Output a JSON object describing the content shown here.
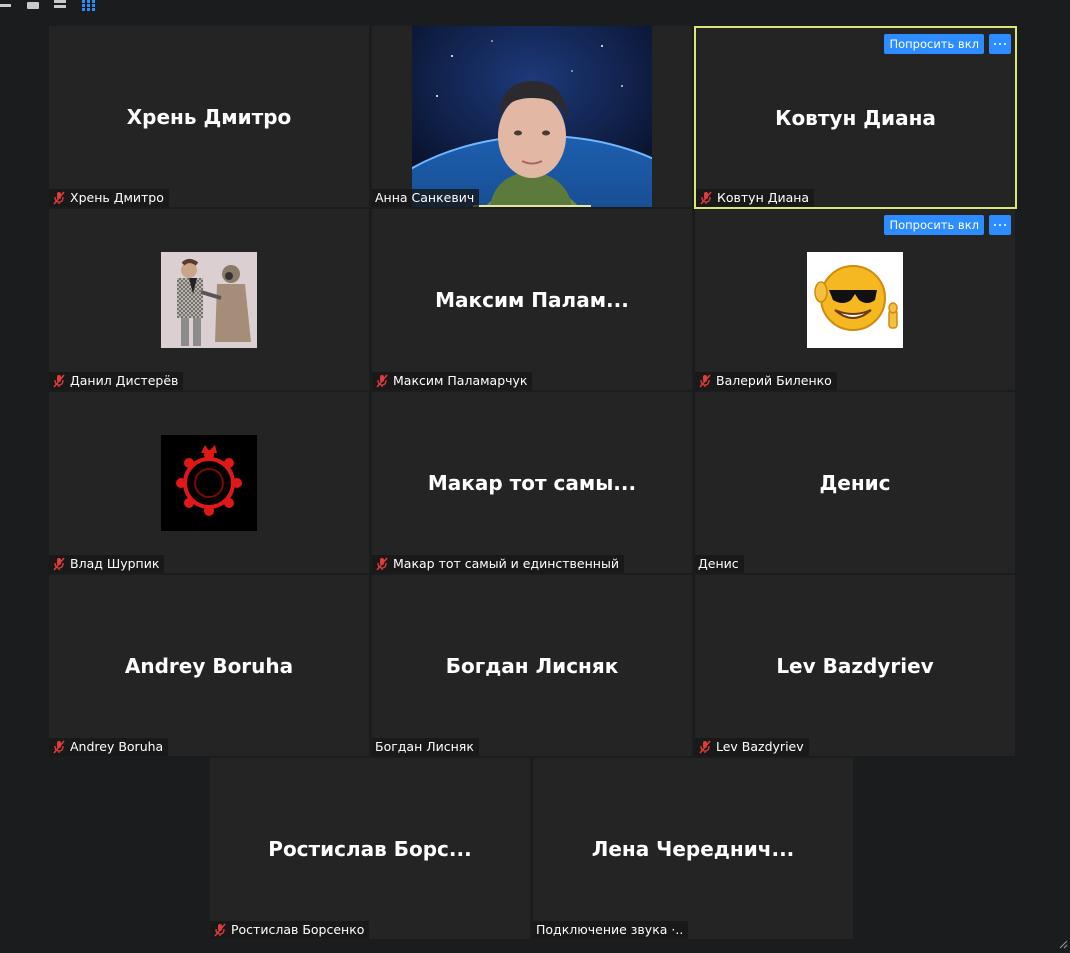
{
  "layout_buttons": [
    {
      "name": "speaker-view",
      "icon": "speaker-view-icon"
    },
    {
      "name": "side-by-side",
      "icon": "side-by-side-icon"
    },
    {
      "name": "stacked",
      "icon": "stacked-view-icon"
    },
    {
      "name": "gallery",
      "icon": "gallery-view-icon",
      "active_color": "#2d8cff"
    }
  ],
  "colors": {
    "ask_button": "#2d8cff",
    "active_border": "#dbe67a",
    "tile_bg": "#242424",
    "muted_icon": "#e03c3c"
  },
  "participants": [
    {
      "big_name": "Хрень Дмитро",
      "name": "Хрень Дмитро",
      "muted": true
    },
    {
      "big_name": "",
      "name": "Анна Санкевич",
      "muted": false,
      "video": true,
      "speaking": true
    },
    {
      "big_name": "Ковтун Диана",
      "name": "Ковтун Диана",
      "muted": true,
      "active": true,
      "ask_label": "Попросить вкл"
    },
    {
      "big_name": "",
      "name": "Данил Дистерёв",
      "muted": true,
      "avatar": "cartoon-figures"
    },
    {
      "big_name": "Максим Палам...",
      "name": "Максим Паламарчук",
      "muted": true
    },
    {
      "big_name": "",
      "name": "Валерий Биленко",
      "muted": true,
      "avatar": "sunglasses-smiley",
      "ask_label": "Попросить вкл"
    },
    {
      "big_name": "",
      "name": "Влад Шурпик",
      "muted": true,
      "avatar": "red-emblem"
    },
    {
      "big_name": "Макар тот самы...",
      "name": "Макар тот самый и единственный",
      "muted": true
    },
    {
      "big_name": "Денис",
      "name": "Денис",
      "muted": false
    },
    {
      "big_name": "Andrey Boruha",
      "name": "Andrey Boruha",
      "muted": true
    },
    {
      "big_name": "Богдан Лисняк",
      "name": "Богдан Лисняк",
      "muted": false
    },
    {
      "big_name": "Lev Bazdyriev",
      "name": "Lev Bazdyriev",
      "muted": true
    },
    {
      "big_name": "Ростислав Борс...",
      "name": "Ростислав Борсенко",
      "muted": true
    },
    {
      "big_name": "Лена Череднич...",
      "name": "Подключение звука ·..",
      "muted": false
    }
  ]
}
